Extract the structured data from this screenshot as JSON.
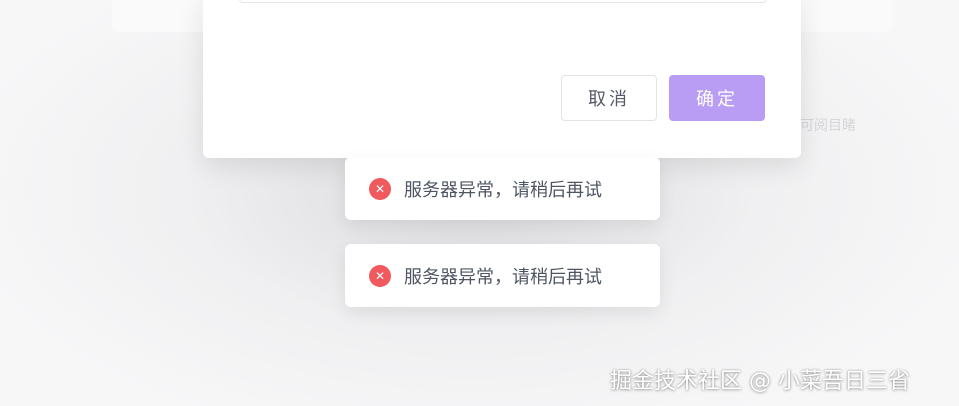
{
  "dialog": {
    "cancel_label": "取消",
    "confirm_label": "确定"
  },
  "background": {
    "ghost_text": "可阅目睹"
  },
  "toasts": [
    {
      "type": "error",
      "icon": "close-circle-icon",
      "text": "服务器异常，请稍后再试"
    },
    {
      "type": "error",
      "icon": "close-circle-icon",
      "text": "服务器异常，请稍后再试"
    }
  ],
  "colors": {
    "confirm_button": "#b99cf4",
    "error_icon": "#f05a5f",
    "toast_text": "#4f5563"
  },
  "watermark": "掘金技术社区 @ 小菜吾日三省"
}
